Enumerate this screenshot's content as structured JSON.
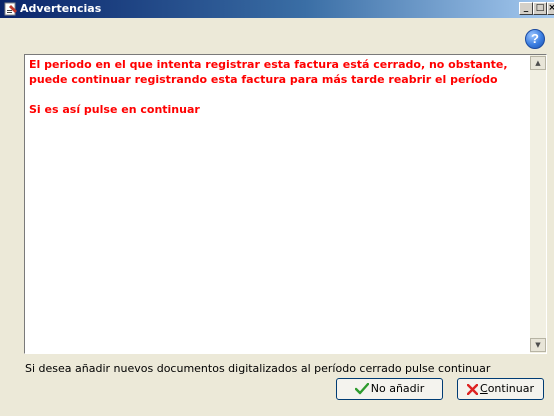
{
  "window": {
    "title": "Advertencias",
    "controls": {
      "minimize": "_",
      "maximize": "□",
      "close": "×"
    }
  },
  "help_icon": "question-icon",
  "message": {
    "line1": "El periodo en el que intenta registrar esta factura está cerrado, no obstante,",
    "line2": "puede continuar registrando esta factura para más tarde reabrir el período",
    "line3": "Si es así pulse en continuar",
    "color": "#ff0000"
  },
  "footer_text": "Si desea añadir nuevos documentos digitalizados al período cerrado pulse continuar",
  "buttons": {
    "no_add": {
      "label": "No añadir",
      "icon": "check-icon"
    },
    "continue": {
      "label_accel": "C",
      "label_rest": "ontinuar",
      "icon": "x-icon"
    }
  }
}
